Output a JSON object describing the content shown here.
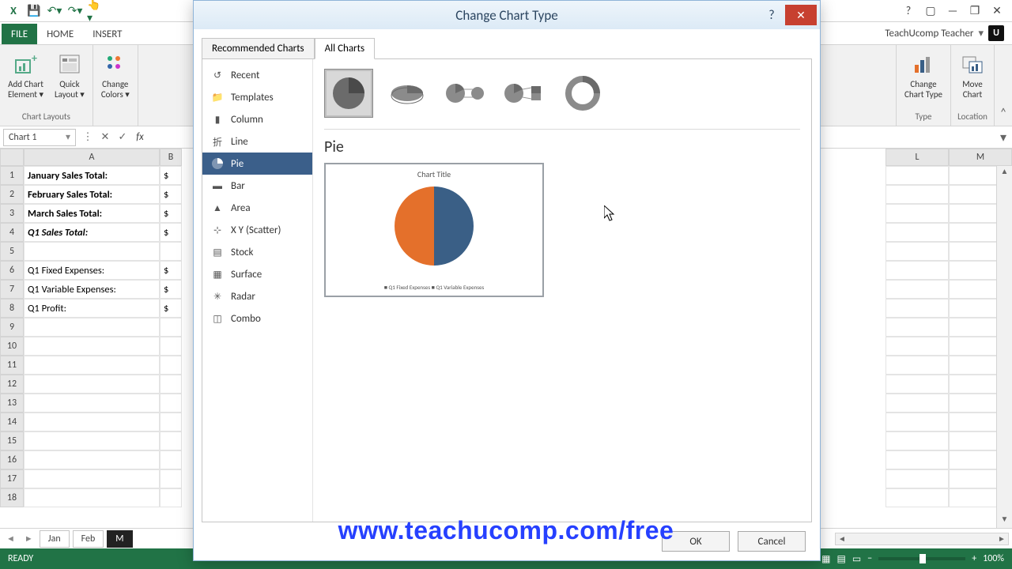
{
  "window": {
    "title": "Change Chart Type"
  },
  "account": {
    "name": "TeachUcomp Teacher",
    "badge": "U"
  },
  "ribbon": {
    "file": "FILE",
    "tabs": [
      "HOME",
      "INSERT"
    ],
    "groups": {
      "chart_layouts": {
        "label": "Chart Layouts",
        "items": [
          {
            "label_line1": "Add Chart",
            "label_line2": "Element ▾"
          },
          {
            "label_line1": "Quick",
            "label_line2": "Layout ▾"
          }
        ]
      },
      "change_colors": {
        "label_line1": "Change",
        "label_line2": "Colors ▾"
      },
      "type": {
        "label": "Type",
        "items": [
          {
            "label_line1": "Change",
            "label_line2": "Chart Type"
          }
        ]
      },
      "location": {
        "label": "Location",
        "items": [
          {
            "label_line1": "Move",
            "label_line2": "Chart"
          }
        ]
      }
    }
  },
  "formula_bar": {
    "name_box": "Chart 1"
  },
  "sheet": {
    "columns": [
      "A",
      "B",
      "L",
      "M"
    ],
    "rows": [
      {
        "n": 1,
        "a": "January Sales Total:",
        "b": "$",
        "bold": true
      },
      {
        "n": 2,
        "a": "February Sales Total:",
        "b": "$",
        "bold": true
      },
      {
        "n": 3,
        "a": "March Sales Total:",
        "b": "$",
        "bold": true
      },
      {
        "n": 4,
        "a": "Q1 Sales Total:",
        "b": "$",
        "bi": true
      },
      {
        "n": 5,
        "a": "",
        "b": ""
      },
      {
        "n": 6,
        "a": "Q1 Fixed Expenses:",
        "b": "$"
      },
      {
        "n": 7,
        "a": "Q1 Variable Expenses:",
        "b": "$"
      },
      {
        "n": 8,
        "a": "Q1 Profit:",
        "b": "$"
      },
      {
        "n": 9,
        "a": "",
        "b": ""
      },
      {
        "n": 10,
        "a": "",
        "b": ""
      },
      {
        "n": 11,
        "a": "",
        "b": ""
      },
      {
        "n": 12,
        "a": "",
        "b": ""
      },
      {
        "n": 13,
        "a": "",
        "b": ""
      },
      {
        "n": 14,
        "a": "",
        "b": ""
      },
      {
        "n": 15,
        "a": "",
        "b": ""
      },
      {
        "n": 16,
        "a": "",
        "b": ""
      },
      {
        "n": 17,
        "a": "",
        "b": ""
      },
      {
        "n": 18,
        "a": "",
        "b": ""
      }
    ],
    "tabs": [
      "Jan",
      "Feb",
      "M"
    ]
  },
  "status": {
    "left": "READY",
    "zoom": "100%"
  },
  "dialog": {
    "title": "Change Chart Type",
    "tabs": {
      "recommended": "Recommended Charts",
      "all": "All Charts"
    },
    "categories": [
      "Recent",
      "Templates",
      "Column",
      "Line",
      "Pie",
      "Bar",
      "Area",
      "X Y (Scatter)",
      "Stock",
      "Surface",
      "Radar",
      "Combo"
    ],
    "selected_category_index": 4,
    "heading": "Pie",
    "preview_title": "Chart Title",
    "preview_legend": "■ Q1 Fixed Expenses    ■ Q1 Variable Expenses",
    "buttons": {
      "ok": "OK",
      "cancel": "Cancel"
    }
  },
  "chart_data": {
    "type": "pie",
    "title": "Chart Title",
    "categories": [
      "Q1 Fixed Expenses",
      "Q1 Variable Expenses"
    ],
    "values": [
      50,
      50
    ],
    "colors": [
      "#3a5f86",
      "#e4702b"
    ]
  },
  "overlay_url": "www.teachucomp.com/free"
}
